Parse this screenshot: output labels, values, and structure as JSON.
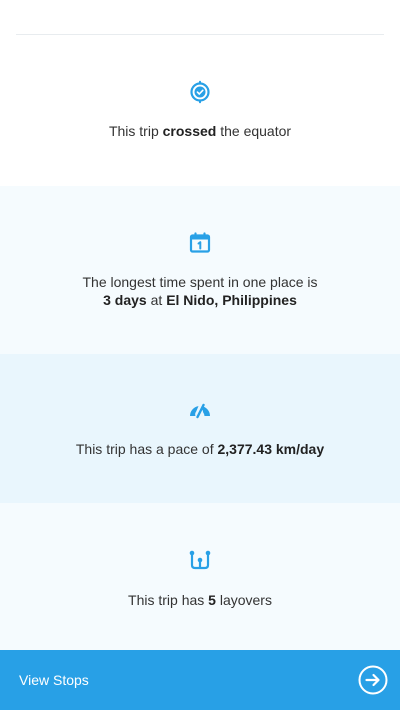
{
  "stats": {
    "equator": {
      "icon": "equator-check-icon",
      "prefix": "This trip ",
      "bold": "crossed",
      "suffix": " the equator"
    },
    "longest_stay": {
      "icon": "calendar-icon",
      "line1": "The longest time spent in one place is",
      "duration": "3 days",
      "at": " at ",
      "place": "El Nido, Philippines"
    },
    "pace": {
      "icon": "speedometer-icon",
      "prefix": "This trip has a pace of ",
      "value": "2,377.43 km/day"
    },
    "layovers": {
      "icon": "layover-icon",
      "prefix": "This trip has ",
      "count": "5",
      "suffix": " layovers"
    }
  },
  "footer": {
    "label": "View Stops",
    "button_icon": "arrow-right-circle-icon"
  },
  "colors": {
    "accent": "#28a0e6",
    "section_light": "#f5fbfe",
    "section_mid": "#e9f6fd"
  }
}
